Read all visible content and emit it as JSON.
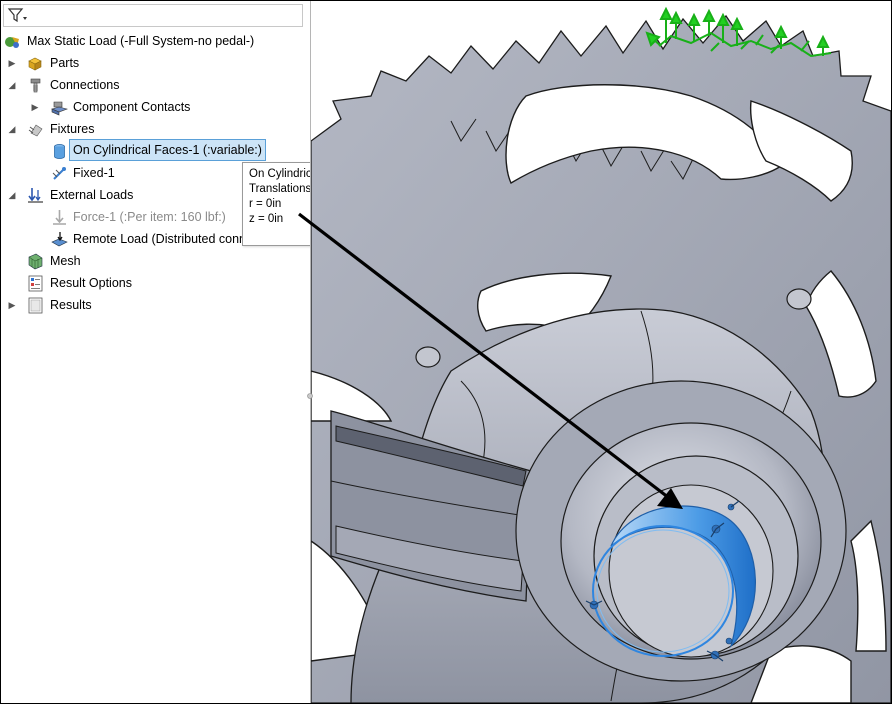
{
  "tree": {
    "study": {
      "label": "Max Static Load (-Full System-no pedal-)",
      "icon": "study-icon"
    },
    "items": [
      {
        "id": "parts",
        "label": "Parts",
        "icon": "parts-icon",
        "expander": "collapsed"
      },
      {
        "id": "connections",
        "label": "Connections",
        "icon": "connections-icon",
        "expander": "expanded"
      },
      {
        "id": "component-contacts",
        "label": "Component Contacts",
        "icon": "component-contacts-icon",
        "expander": "collapsed"
      },
      {
        "id": "fixtures",
        "label": "Fixtures",
        "icon": "fixtures-icon",
        "expander": "expanded"
      },
      {
        "id": "on-cylindrical-faces",
        "label": "On Cylindrical Faces-1 (:variable:)",
        "icon": "cylindrical-fixture-icon",
        "selected": true
      },
      {
        "id": "fixed-1",
        "label": "Fixed-1",
        "icon": "fixed-geometry-icon"
      },
      {
        "id": "external-loads",
        "label": "External Loads",
        "icon": "external-loads-icon",
        "expander": "expanded"
      },
      {
        "id": "force-1",
        "label": "Force-1 (:Per item: 160 lbf:)",
        "icon": "force-icon",
        "suppressed": true
      },
      {
        "id": "remote-load",
        "label": "Remote Load (Distributed conne",
        "icon": "remote-load-icon"
      },
      {
        "id": "mesh",
        "label": "Mesh",
        "icon": "mesh-icon"
      },
      {
        "id": "result-options",
        "label": "Result Options",
        "icon": "result-options-icon"
      },
      {
        "id": "results",
        "label": "Results",
        "icon": "results-icon",
        "expander": "collapsed"
      }
    ]
  },
  "tooltip": {
    "title": "On Cylindrical Faces",
    "subtitle": "Translations:",
    "line1": "r = 0in",
    "line2": "z = 0in"
  },
  "colors": {
    "part_face": "#a9adb9",
    "part_edge": "#1c1c1c",
    "highlight": "#3a8fe0",
    "load_arrows": "#1ec81e",
    "selection_bg": "#cce4f7"
  }
}
